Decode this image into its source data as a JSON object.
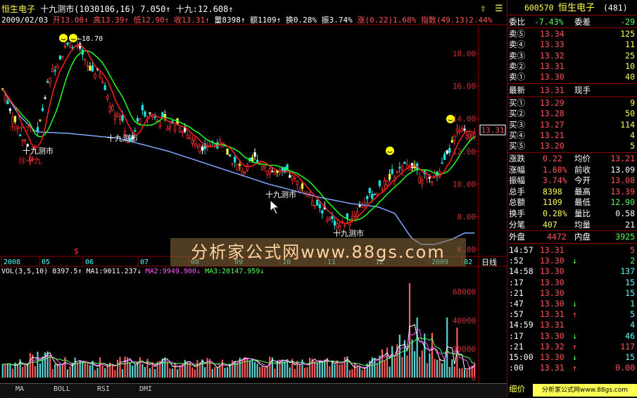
{
  "header": {
    "name": "恒生电子",
    "indicator": "十九测市",
    "params": "(1030106,16)",
    "p1": "7.050",
    "p2_label": "十九:",
    "p2": "12.608"
  },
  "stats_bar": {
    "date": "2009/02/03",
    "open": "开13.08",
    "high": "高13.39",
    "low": "低12.90",
    "close": "收13.31",
    "vol": "量8398",
    "amt": "额1109",
    "turnover": "换0.28%",
    "amplitude": "振3.74%",
    "change": "涨(0.22)1.68%",
    "index": "指数(49.13)2.44%"
  },
  "vol_header": {
    "name": "VOL(3,5,10)",
    "value": "8397.5",
    "ma1": "MA1:9011.237",
    "ma2": "MA2:9949.900",
    "ma3": "MA3:20147.959"
  },
  "price_axis": [
    "18.00",
    "16.00",
    "14.00",
    "12.00",
    "10.00",
    "8.00",
    "6.00"
  ],
  "current_price_tag": "13.31",
  "vol_axis": [
    "60000",
    "40000",
    "20000",
    "0"
  ],
  "x_axis": [
    "2008",
    "05",
    "06",
    "07",
    "08",
    "09",
    "10",
    "11",
    "12",
    "2009",
    "02"
  ],
  "period_label": "日线",
  "chart_annotations": {
    "max": "18.70",
    "ann1": "十九测市",
    "ann2": "十九测市",
    "ann3": "十九测市",
    "ann4": "十九测市",
    "ann_circle": "⑬十九",
    "ann_circle2": "⑬十九",
    "marker_s": "$"
  },
  "tabs": [
    "MA",
    "BOLL",
    "RSI",
    "DMI"
  ],
  "watermark": "分析家公式网www.88gs.com",
  "watermark_small": "分析家公式网www.88gs.com",
  "quote": {
    "code": "600570",
    "name": "恒生电子",
    "num": "(481)",
    "weibi_label": "委比",
    "weibi": "-7.43%",
    "weicha_label": "委差",
    "weicha": "-29",
    "sells": [
      {
        "label": "卖⑤",
        "price": "13.34",
        "vol": "125"
      },
      {
        "label": "卖④",
        "price": "13.33",
        "vol": "11"
      },
      {
        "label": "卖③",
        "price": "13.32",
        "vol": "25"
      },
      {
        "label": "卖②",
        "price": "13.31",
        "vol": "10"
      },
      {
        "label": "卖①",
        "price": "13.30",
        "vol": "40"
      }
    ],
    "latest_label": "最新",
    "latest": "13.31",
    "current_hand_label": "现手",
    "buys": [
      {
        "label": "买①",
        "price": "13.29",
        "vol": "9"
      },
      {
        "label": "买②",
        "price": "13.28",
        "vol": "50"
      },
      {
        "label": "买③",
        "price": "13.27",
        "vol": "114"
      },
      {
        "label": "买④",
        "price": "13.21",
        "vol": "4"
      },
      {
        "label": "买⑤",
        "price": "13.20",
        "vol": "5"
      }
    ],
    "details": [
      {
        "l1": "涨跌",
        "v1": "0.22",
        "l2": "均价",
        "v2": "13.21"
      },
      {
        "l1": "涨幅",
        "v1": "1.68%",
        "l2": "前收",
        "v2": "13.09"
      },
      {
        "l1": "振幅",
        "v1": "3.74%",
        "l2": "今开",
        "v2": "13.08"
      },
      {
        "l1": "总手",
        "v1": "8398",
        "l2": "最高",
        "v2": "13.39"
      },
      {
        "l1": "总额",
        "v1": "1109",
        "l2": "最低",
        "v2": "12.90"
      },
      {
        "l1": "换手",
        "v1": "0.28%",
        "l2": "量比",
        "v2": "0.58"
      },
      {
        "l1": "分笔",
        "v1": "407",
        "l2": "均量",
        "v2": "21"
      }
    ],
    "outer_label": "外盘",
    "outer": "4472",
    "inner_label": "内盘",
    "inner": "3925"
  },
  "ticks": [
    {
      "t": "14:57",
      "p": "13.31",
      "a": "",
      "v": "5",
      "c": "r"
    },
    {
      "t": ":52",
      "p": "13.30",
      "a": "↓",
      "v": "2",
      "c": "g"
    },
    {
      "t": "14:58",
      "p": "13.30",
      "a": "",
      "v": "137",
      "c": "c"
    },
    {
      "t": ":17",
      "p": "13.30",
      "a": "",
      "v": "15",
      "c": "c"
    },
    {
      "t": ":21",
      "p": "13.30",
      "a": "",
      "v": "15",
      "c": "c"
    },
    {
      "t": ":47",
      "p": "13.30",
      "a": "↓",
      "v": "1",
      "c": "c"
    },
    {
      "t": ":57",
      "p": "13.31",
      "a": "↑",
      "v": "5",
      "c": "c"
    },
    {
      "t": "14:59",
      "p": "13.31",
      "a": "",
      "v": "4",
      "c": "c"
    },
    {
      "t": ":17",
      "p": "13.30",
      "a": "↓",
      "v": "46",
      "c": "c"
    },
    {
      "t": ":21",
      "p": "13.32",
      "a": "↑",
      "v": "117",
      "c": "r"
    },
    {
      "t": "15:00",
      "p": "13.30",
      "a": "↓",
      "v": "15",
      "c": "c"
    },
    {
      "t": ":00",
      "p": "13.31",
      "a": "↑",
      "v": "0.00",
      "c": "r"
    }
  ],
  "detail_label": "细价",
  "chart_data": {
    "type": "candlestick",
    "y_range": [
      6,
      19.2
    ],
    "vol_range": [
      0,
      68000
    ],
    "count": 190,
    "ma_colors": {
      "ma_short": "#ff2020",
      "ma_mid": "#20ff20",
      "ma_long": "#7fa7ff"
    },
    "closes_anchor": [
      [
        0,
        15.8
      ],
      [
        10,
        13.2
      ],
      [
        18,
        11.6
      ],
      [
        28,
        16.5
      ],
      [
        38,
        18.4
      ],
      [
        44,
        18.6
      ],
      [
        52,
        17.0
      ],
      [
        58,
        16.8
      ],
      [
        66,
        14.6
      ],
      [
        72,
        14.0
      ],
      [
        76,
        12.4
      ],
      [
        84,
        14.4
      ],
      [
        92,
        14.2
      ],
      [
        100,
        13.6
      ],
      [
        106,
        13.7
      ],
      [
        112,
        12.9
      ],
      [
        120,
        12.3
      ],
      [
        126,
        12.5
      ],
      [
        132,
        12.4
      ],
      [
        140,
        11.2
      ],
      [
        146,
        10.8
      ],
      [
        152,
        11.6
      ],
      [
        158,
        11.1
      ],
      [
        166,
        10.6
      ],
      [
        172,
        10.6
      ],
      [
        180,
        9.8
      ],
      [
        188,
        8.9
      ],
      [
        196,
        8.0
      ],
      [
        203,
        7.4
      ],
      [
        210,
        8.0
      ],
      [
        218,
        9.0
      ],
      [
        226,
        9.6
      ],
      [
        234,
        10.4
      ],
      [
        240,
        10.9
      ],
      [
        246,
        11.3
      ],
      [
        252,
        10.5
      ],
      [
        258,
        10.3
      ],
      [
        266,
        11.3
      ],
      [
        274,
        13.3
      ],
      [
        279,
        13.1
      ],
      [
        284,
        13.31
      ]
    ],
    "ma_long_anchor": [
      [
        0,
        15.8
      ],
      [
        10,
        14.2
      ],
      [
        20,
        13.2
      ],
      [
        40,
        13.1
      ],
      [
        70,
        12.8
      ],
      [
        100,
        12.0
      ],
      [
        130,
        11.0
      ],
      [
        160,
        10.0
      ],
      [
        190,
        9.2
      ],
      [
        210,
        8.8
      ],
      [
        226,
        8.6
      ],
      [
        236,
        8.2
      ],
      [
        246,
        6.7
      ],
      [
        252,
        6.3
      ],
      [
        260,
        6.3
      ],
      [
        270,
        6.6
      ],
      [
        278,
        7.0
      ],
      [
        284,
        7.0
      ]
    ],
    "volumes_hint": "mostly 5000-15000 with spikes up to 66000 near 2009-01"
  }
}
